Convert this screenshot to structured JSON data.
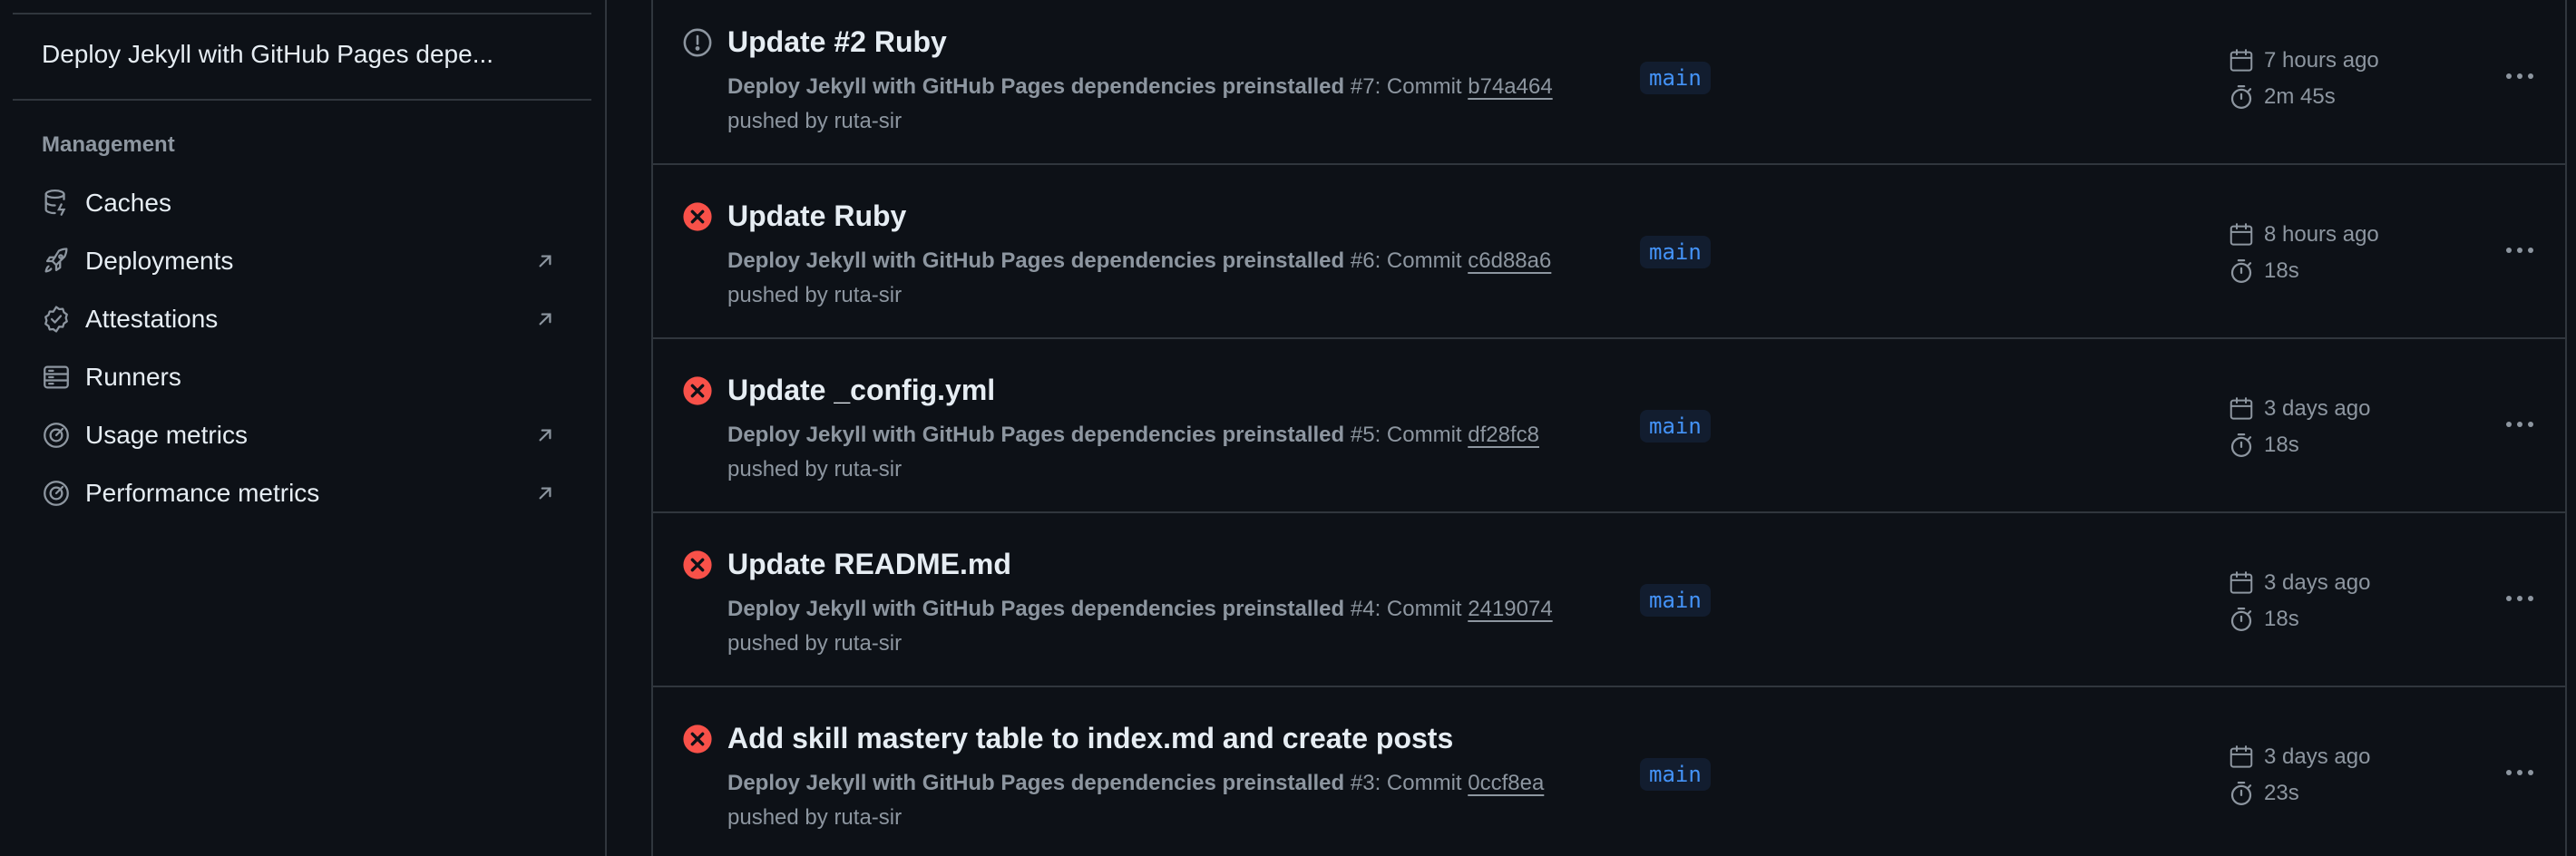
{
  "sidebar": {
    "workflow_item": "Deploy Jekyll with GitHub Pages depe...",
    "management_heading": "Management",
    "items": [
      {
        "label": "Caches",
        "icon": "database-icon",
        "external": false
      },
      {
        "label": "Deployments",
        "icon": "rocket-icon",
        "external": true
      },
      {
        "label": "Attestations",
        "icon": "verified-icon",
        "external": true
      },
      {
        "label": "Runners",
        "icon": "server-icon",
        "external": false
      },
      {
        "label": "Usage metrics",
        "icon": "meter-icon",
        "external": true
      },
      {
        "label": "Performance metrics",
        "icon": "meter-icon",
        "external": true
      }
    ]
  },
  "runs": [
    {
      "status": "neutral",
      "status_icon": "alert-circle-icon",
      "title": "Update #2 Ruby",
      "workflow": "Deploy Jekyll with GitHub Pages dependencies preinstalled",
      "number": "#7",
      "commit_label": ": Commit",
      "commit": "b74a464",
      "pushed_by": "pushed by",
      "user": "ruta-sir",
      "branch": "main",
      "time_ago": "7 hours ago",
      "duration": "2m 45s"
    },
    {
      "status": "failure",
      "status_icon": "x-circle-fill-icon",
      "title": "Update Ruby",
      "workflow": "Deploy Jekyll with GitHub Pages dependencies preinstalled",
      "number": "#6",
      "commit_label": ": Commit",
      "commit": "c6d88a6",
      "pushed_by": "pushed by",
      "user": "ruta-sir",
      "branch": "main",
      "time_ago": "8 hours ago",
      "duration": "18s"
    },
    {
      "status": "failure",
      "status_icon": "x-circle-fill-icon",
      "title": "Update _config.yml",
      "workflow": "Deploy Jekyll with GitHub Pages dependencies preinstalled",
      "number": "#5",
      "commit_label": ": Commit",
      "commit": "df28fc8",
      "pushed_by": "pushed by",
      "user": "ruta-sir",
      "branch": "main",
      "time_ago": "3 days ago",
      "duration": "18s"
    },
    {
      "status": "failure",
      "status_icon": "x-circle-fill-icon",
      "title": "Update README.md",
      "workflow": "Deploy Jekyll with GitHub Pages dependencies preinstalled",
      "number": "#4",
      "commit_label": ": Commit",
      "commit": "2419074",
      "pushed_by": "pushed by",
      "user": "ruta-sir",
      "branch": "main",
      "time_ago": "3 days ago",
      "duration": "18s"
    },
    {
      "status": "failure",
      "status_icon": "x-circle-fill-icon",
      "title": "Add skill mastery table to index.md and create posts",
      "workflow": "Deploy Jekyll with GitHub Pages dependencies preinstalled",
      "number": "#3",
      "commit_label": ": Commit",
      "commit": "0ccf8ea",
      "pushed_by": "pushed by",
      "user": "ruta-sir",
      "branch": "main",
      "time_ago": "3 days ago",
      "duration": "23s"
    }
  ],
  "colors": {
    "background": "#0d1117",
    "border": "#30363d",
    "text": "#e6edf3",
    "muted": "#8d96a0",
    "failure": "#f85149",
    "branch_bg": "#121d2f",
    "branch_fg": "#4493f8"
  }
}
